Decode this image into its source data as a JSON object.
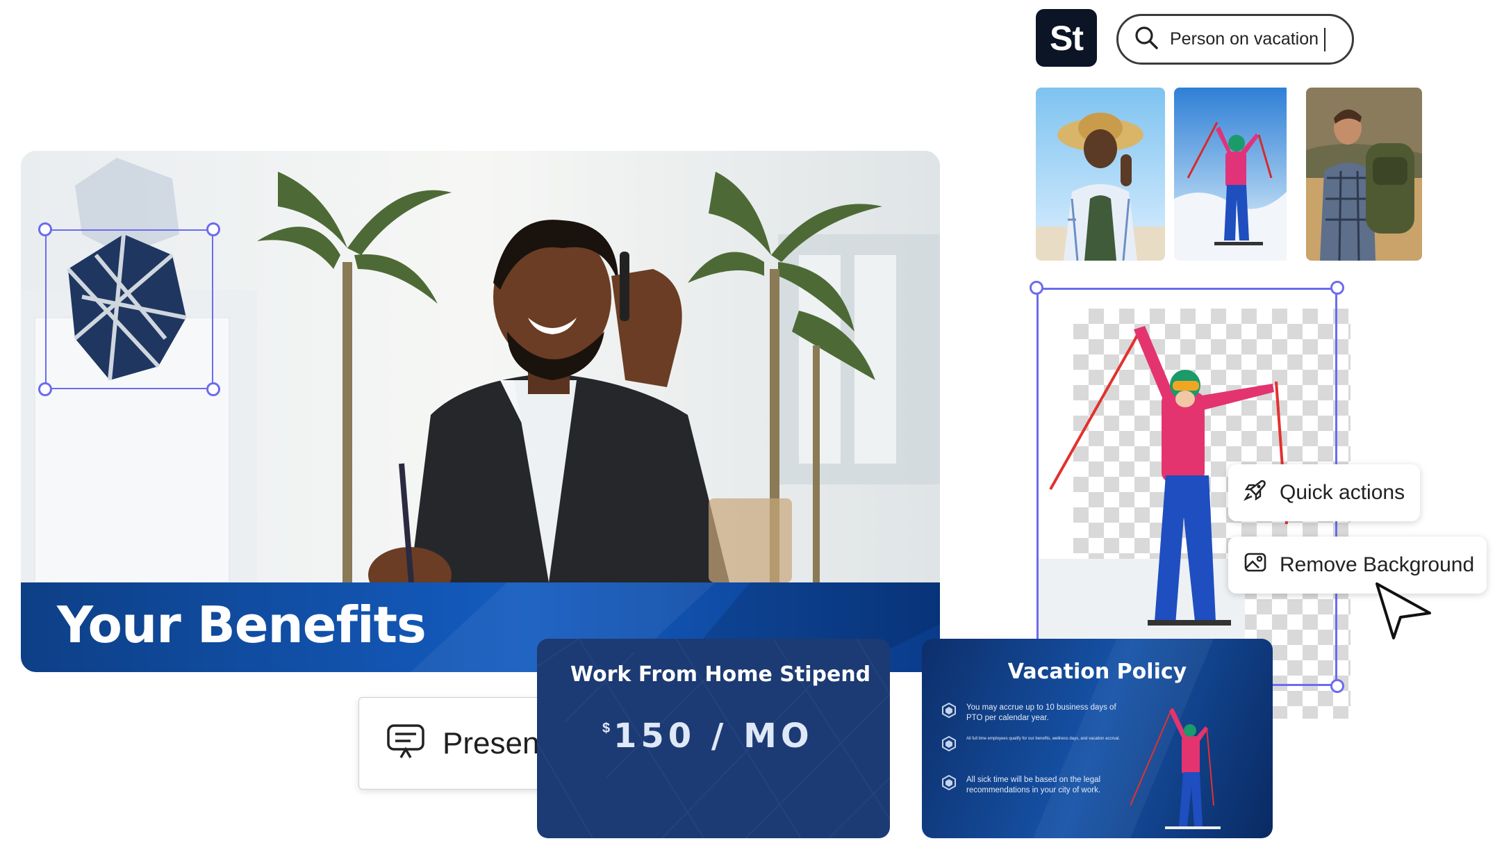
{
  "stock": {
    "badge": "St",
    "search_value": "Person on vacation"
  },
  "thumbnails": [
    {
      "label": "woman-in-sun-hat"
    },
    {
      "label": "skier-with-poles"
    },
    {
      "label": "hiker-with-backpack"
    }
  ],
  "hero": {
    "title": "Your Benefits"
  },
  "context_menu": {
    "quick_actions": "Quick actions",
    "remove_background": "Remove Background"
  },
  "present_button": "Present",
  "wfh_card": {
    "title": "Work From Home Stipend",
    "dollar": "$",
    "amount": "150 / MO"
  },
  "vacation_card": {
    "title": "Vacation Policy",
    "items": [
      "You may accrue up to 10 business days of PTO per calendar year.",
      "All full time employees qualify for our benefits, wellness days, and vacation accrual.",
      "All sick time will be based on the legal recommendations in your city of work."
    ]
  },
  "colors": {
    "accent_selection": "#6b6bf0",
    "banner_blue": "#145cc0",
    "card_navy": "#1c3a73",
    "stock_badge": "#0b1526"
  }
}
